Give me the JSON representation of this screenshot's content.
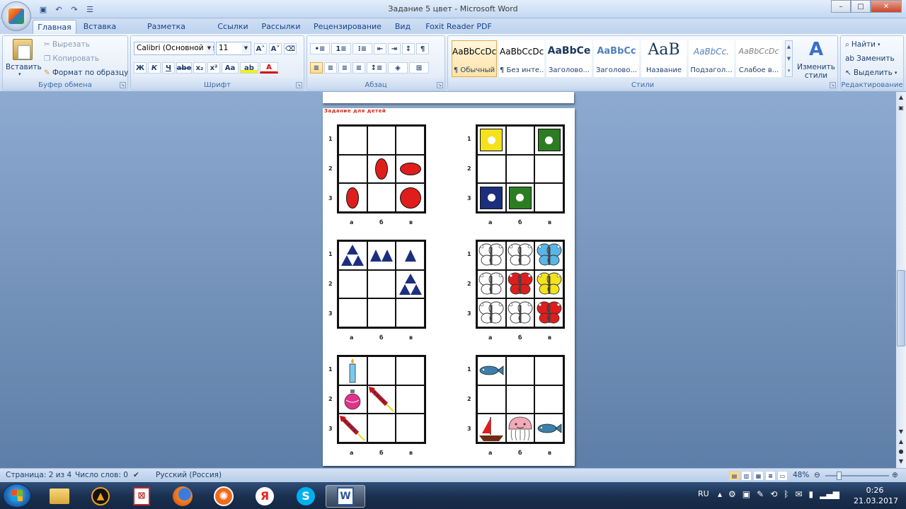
{
  "window": {
    "title": "Задание 5 цвет - Microsoft Word",
    "controls": {
      "minimize": "–",
      "maximize": "□",
      "close": "✕"
    }
  },
  "qat": {
    "save": "▣",
    "undo": "↶",
    "redo": "↷",
    "print_preview": "☰"
  },
  "tabs": [
    {
      "label": "Главная",
      "active": true
    },
    {
      "label": "Вставка"
    },
    {
      "label": "Разметка страницы"
    },
    {
      "label": "Ссылки"
    },
    {
      "label": "Рассылки"
    },
    {
      "label": "Рецензирование"
    },
    {
      "label": "Вид"
    },
    {
      "label": "Foxit Reader PDF"
    }
  ],
  "ribbon": {
    "clipboard": {
      "label": "Буфер обмена",
      "paste": "Вставить",
      "cut": "Вырезать",
      "copy": "Копировать",
      "format_painter": "Формат по образцу"
    },
    "font": {
      "label": "Шрифт",
      "font_name": "Calibri (Основной те",
      "font_size": "11",
      "bold": "Ж",
      "italic": "К",
      "underline": "Ч",
      "strike": "abe",
      "subscript": "x₂",
      "superscript": "x²",
      "change_case": "Aa",
      "grow": "A˄",
      "shrink": "A˅",
      "highlight": "ab",
      "font_color": "A"
    },
    "paragraph": {
      "label": "Абзац"
    },
    "styles": {
      "label": "Стили",
      "items": [
        {
          "sample": "AaBbCcDc",
          "name": "¶ Обычный",
          "selected": true
        },
        {
          "sample": "AaBbCcDc",
          "name": "¶ Без инте..."
        },
        {
          "sample": "AaBbCе",
          "name": "Заголово..."
        },
        {
          "sample": "AaBbCc",
          "name": "Заголово..."
        },
        {
          "sample": "AaB",
          "name": "Название"
        },
        {
          "sample": "AaBbCc.",
          "name": "Подзагол..."
        },
        {
          "sample": "AaBbCcDc",
          "name": "Слабое в..."
        }
      ],
      "change_styles": "Изменить стили"
    },
    "editing": {
      "label": "Редактирование",
      "find": "Найти",
      "replace": "Заменить",
      "select": "Выделить"
    }
  },
  "document": {
    "row_labels": [
      "1",
      "2",
      "3"
    ],
    "col_labels": [
      "а",
      "б",
      "в"
    ],
    "heading": "Задание для детей"
  },
  "statusbar": {
    "page": "Страница: 2 из 4",
    "words": "Число слов: 0",
    "language": "Русский (Россия)",
    "zoom": "48%"
  },
  "taskbar": {
    "lang": "RU",
    "time": "0:26",
    "date": "21.03.2017"
  },
  "colors": {
    "red": "#e01d1d",
    "navy": "#1b2f7d",
    "yellow": "#f4e21b",
    "green": "#2c7d22",
    "blue": "#5ab6e8"
  }
}
